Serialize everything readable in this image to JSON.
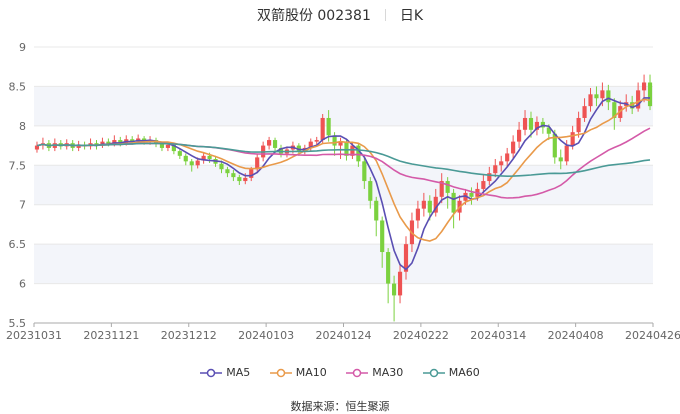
{
  "header": {
    "title": "双箭股份 002381",
    "period": "日K"
  },
  "source": "数据来源：恒生聚源",
  "colors": {
    "up": "#ee5353",
    "down": "#7bd13f",
    "grid_band": "#f3f5fa",
    "axis": "#999999"
  },
  "legend": [
    {
      "name": "MA5",
      "color": "#5a4fb3"
    },
    {
      "name": "MA10",
      "color": "#e99a4a"
    },
    {
      "name": "MA30",
      "color": "#d45aa8"
    },
    {
      "name": "MA60",
      "color": "#4a9a96"
    }
  ],
  "chart_data": {
    "type": "candlestick",
    "title": "双箭股份 002381",
    "period": "日K",
    "ylim": [
      5.5,
      9
    ],
    "yticks": [
      "9",
      "8.5",
      "8",
      "7.5",
      "7",
      "6.5",
      "6",
      "5.5"
    ],
    "xticks": [
      "20231031",
      "20231121",
      "20231212",
      "20240103",
      "20240124",
      "20240222",
      "20240314",
      "20240408",
      "20240426"
    ],
    "grid": true,
    "legend_position": "bottom",
    "candles": [
      [
        7.7,
        7.75,
        7.66,
        7.8
      ],
      [
        7.75,
        7.78,
        7.7,
        7.85
      ],
      [
        7.78,
        7.72,
        7.68,
        7.82
      ],
      [
        7.72,
        7.78,
        7.68,
        7.84
      ],
      [
        7.78,
        7.74,
        7.7,
        7.82
      ],
      [
        7.74,
        7.78,
        7.7,
        7.83
      ],
      [
        7.78,
        7.72,
        7.68,
        7.82
      ],
      [
        7.72,
        7.76,
        7.68,
        7.81
      ],
      [
        7.76,
        7.74,
        7.7,
        7.8
      ],
      [
        7.74,
        7.78,
        7.7,
        7.84
      ],
      [
        7.78,
        7.75,
        7.7,
        7.82
      ],
      [
        7.75,
        7.8,
        7.72,
        7.85
      ],
      [
        7.8,
        7.77,
        7.74,
        7.84
      ],
      [
        7.77,
        7.82,
        7.74,
        7.88
      ],
      [
        7.82,
        7.78,
        7.74,
        7.86
      ],
      [
        7.78,
        7.83,
        7.75,
        7.88
      ],
      [
        7.83,
        7.8,
        7.76,
        7.87
      ],
      [
        7.8,
        7.84,
        7.77,
        7.89
      ],
      [
        7.84,
        7.8,
        7.76,
        7.87
      ],
      [
        7.8,
        7.82,
        7.76,
        7.87
      ],
      [
        7.82,
        7.77,
        7.73,
        7.85
      ],
      [
        7.77,
        7.72,
        7.68,
        7.8
      ],
      [
        7.72,
        7.76,
        7.68,
        7.8
      ],
      [
        7.76,
        7.68,
        7.64,
        7.79
      ],
      [
        7.68,
        7.62,
        7.58,
        7.71
      ],
      [
        7.62,
        7.55,
        7.5,
        7.65
      ],
      [
        7.55,
        7.5,
        7.42,
        7.58
      ],
      [
        7.5,
        7.56,
        7.46,
        7.6
      ],
      [
        7.56,
        7.62,
        7.52,
        7.66
      ],
      [
        7.62,
        7.58,
        7.53,
        7.66
      ],
      [
        7.58,
        7.52,
        7.48,
        7.62
      ],
      [
        7.52,
        7.45,
        7.4,
        7.56
      ],
      [
        7.45,
        7.4,
        7.35,
        7.48
      ],
      [
        7.4,
        7.35,
        7.3,
        7.44
      ],
      [
        7.35,
        7.3,
        7.25,
        7.38
      ],
      [
        7.3,
        7.34,
        7.26,
        7.4
      ],
      [
        7.34,
        7.45,
        7.3,
        7.48
      ],
      [
        7.45,
        7.6,
        7.4,
        7.65
      ],
      [
        7.6,
        7.75,
        7.55,
        7.8
      ],
      [
        7.75,
        7.82,
        7.7,
        7.86
      ],
      [
        7.82,
        7.72,
        7.66,
        7.85
      ],
      [
        7.72,
        7.65,
        7.6,
        7.76
      ],
      [
        7.65,
        7.7,
        7.6,
        7.74
      ],
      [
        7.7,
        7.75,
        7.65,
        7.8
      ],
      [
        7.75,
        7.68,
        7.62,
        7.78
      ],
      [
        7.68,
        7.72,
        7.64,
        7.76
      ],
      [
        7.72,
        7.8,
        7.68,
        7.84
      ],
      [
        7.8,
        7.82,
        7.75,
        7.86
      ],
      [
        7.82,
        8.1,
        7.78,
        8.15
      ],
      [
        8.1,
        7.88,
        7.8,
        8.2
      ],
      [
        7.88,
        7.75,
        7.62,
        7.92
      ],
      [
        7.75,
        7.8,
        7.58,
        7.85
      ],
      [
        7.8,
        7.62,
        7.56,
        7.84
      ],
      [
        7.62,
        7.75,
        7.58,
        7.8
      ],
      [
        7.75,
        7.55,
        7.48,
        7.78
      ],
      [
        7.55,
        7.3,
        7.2,
        7.6
      ],
      [
        7.3,
        7.05,
        6.95,
        7.35
      ],
      [
        7.05,
        6.8,
        6.6,
        7.1
      ],
      [
        6.8,
        6.4,
        6.2,
        6.85
      ],
      [
        6.4,
        6.0,
        5.75,
        6.45
      ],
      [
        6.0,
        5.85,
        5.52,
        6.1
      ],
      [
        5.85,
        6.15,
        5.75,
        6.25
      ],
      [
        6.15,
        6.5,
        6.05,
        6.6
      ],
      [
        6.5,
        6.8,
        6.4,
        6.9
      ],
      [
        6.8,
        6.95,
        6.7,
        7.05
      ],
      [
        6.95,
        7.05,
        6.85,
        7.15
      ],
      [
        7.05,
        6.9,
        6.8,
        7.12
      ],
      [
        6.9,
        7.1,
        6.85,
        7.2
      ],
      [
        7.1,
        7.3,
        7.02,
        7.4
      ],
      [
        7.3,
        7.15,
        6.95,
        7.35
      ],
      [
        7.15,
        6.9,
        6.7,
        7.2
      ],
      [
        6.9,
        7.05,
        6.8,
        7.12
      ],
      [
        7.05,
        7.15,
        7.0,
        7.2
      ],
      [
        7.15,
        7.1,
        7.0,
        7.22
      ],
      [
        7.1,
        7.2,
        7.05,
        7.28
      ],
      [
        7.2,
        7.3,
        7.15,
        7.38
      ],
      [
        7.3,
        7.4,
        7.25,
        7.48
      ],
      [
        7.4,
        7.5,
        7.35,
        7.58
      ],
      [
        7.5,
        7.55,
        7.42,
        7.62
      ],
      [
        7.55,
        7.65,
        7.48,
        7.72
      ],
      [
        7.65,
        7.8,
        7.58,
        7.88
      ],
      [
        7.8,
        7.95,
        7.72,
        8.05
      ],
      [
        7.95,
        8.1,
        7.88,
        8.2
      ],
      [
        8.1,
        7.95,
        7.85,
        8.18
      ],
      [
        7.95,
        8.05,
        7.88,
        8.12
      ],
      [
        8.05,
        7.98,
        7.9,
        8.1
      ],
      [
        7.98,
        7.9,
        7.82,
        8.02
      ],
      [
        7.9,
        7.6,
        7.52,
        7.95
      ],
      [
        7.6,
        7.55,
        7.45,
        7.7
      ],
      [
        7.55,
        7.75,
        7.5,
        7.82
      ],
      [
        7.75,
        7.92,
        7.7,
        8.0
      ],
      [
        7.92,
        8.1,
        7.85,
        8.18
      ],
      [
        8.1,
        8.25,
        8.05,
        8.35
      ],
      [
        8.25,
        8.4,
        8.18,
        8.48
      ],
      [
        8.4,
        8.35,
        8.25,
        8.5
      ],
      [
        8.35,
        8.45,
        8.25,
        8.55
      ],
      [
        8.45,
        8.3,
        8.2,
        8.52
      ],
      [
        8.3,
        8.1,
        7.95,
        8.35
      ],
      [
        8.1,
        8.25,
        8.05,
        8.32
      ],
      [
        8.25,
        8.3,
        8.18,
        8.4
      ],
      [
        8.3,
        8.22,
        8.15,
        8.38
      ],
      [
        8.22,
        8.45,
        8.18,
        8.55
      ],
      [
        8.45,
        8.55,
        8.3,
        8.65
      ],
      [
        8.55,
        8.25,
        8.2,
        8.65
      ]
    ]
  }
}
